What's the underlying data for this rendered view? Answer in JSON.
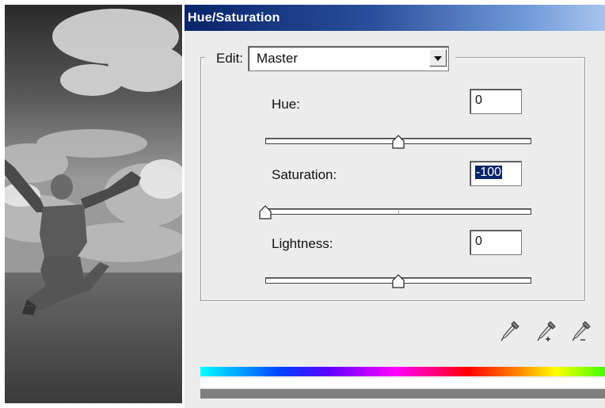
{
  "dialog": {
    "title": "Hue/Saturation",
    "edit": {
      "label": "Edit:",
      "selected": "Master"
    },
    "hue": {
      "label": "Hue:",
      "value": "0",
      "slider_fraction": 0.5
    },
    "saturation": {
      "label": "Saturation:",
      "value": "-100",
      "slider_fraction": 0.0
    },
    "lightness": {
      "label": "Lightness:",
      "value": "0",
      "slider_fraction": 0.5
    },
    "eyedroppers": [
      "eyedropper-icon",
      "eyedropper-plus-icon",
      "eyedropper-minus-icon"
    ]
  },
  "colors": {
    "titlebar_start": "#08246b",
    "titlebar_end": "#a6c4ee",
    "dialog_bg": "#ececec",
    "selection": "#0a246a"
  }
}
